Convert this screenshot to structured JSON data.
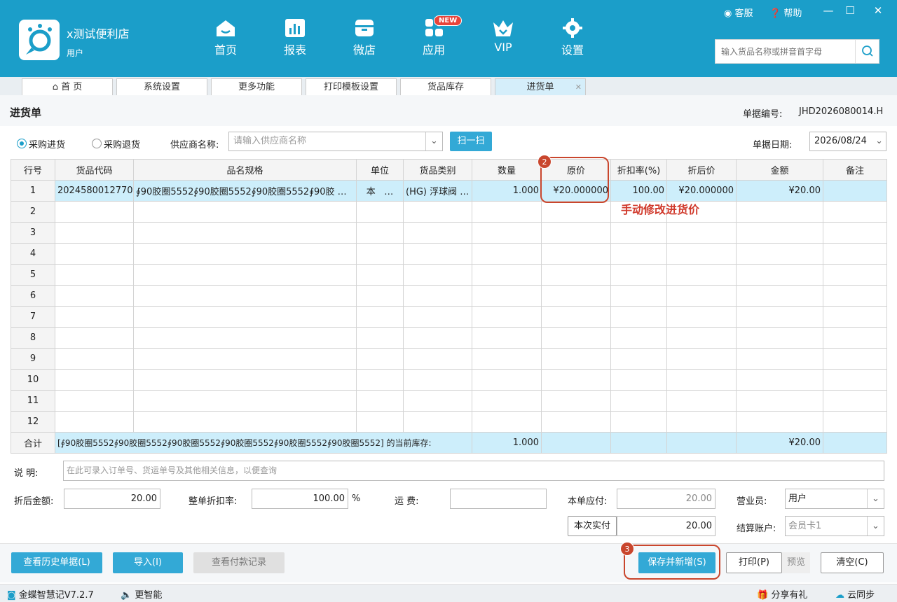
{
  "app": {
    "shop_name": "x测试便利店",
    "user": "用户"
  },
  "nav": [
    {
      "label": "首页",
      "icon": "home-icon"
    },
    {
      "label": "报表",
      "icon": "report-icon"
    },
    {
      "label": "微店",
      "icon": "store-icon"
    },
    {
      "label": "应用",
      "icon": "apps-icon",
      "badge": "NEW"
    },
    {
      "label": "VIP",
      "icon": "vip-crown-icon"
    },
    {
      "label": "设置",
      "icon": "gear-icon"
    }
  ],
  "top_links": {
    "service": "客服",
    "help": "帮助"
  },
  "search": {
    "placeholder": "输入货品名称或拼音首字母"
  },
  "tabs": [
    "首 页",
    "系统设置",
    "更多功能",
    "打印模板设置",
    "货品库存",
    "进货单"
  ],
  "page": {
    "title": "进货单",
    "docno_label": "单据编号:",
    "docno": "JHD2026080014.H"
  },
  "form": {
    "radio_purchase": "采购进货",
    "radio_return": "采购退货",
    "supplier_label": "供应商名称:",
    "supplier_placeholder": "请输入供应商名称",
    "scan_button": "扫一扫",
    "date_label": "单据日期:",
    "date_value": "2026/08/24"
  },
  "grid": {
    "headers": [
      "行号",
      "货品代码",
      "品名规格",
      "单位",
      "货品类别",
      "数量",
      "原价",
      "折扣率(%)",
      "折后价",
      "金额",
      "备注"
    ],
    "row1": {
      "no": "1",
      "code": "2024580012770",
      "name": "∮90胶圈5552∮90胶圈5552∮90胶圈5552∮90胶",
      "unit": "本",
      "category": "(HG) 浮球阀",
      "qty": "1.000",
      "price": "¥20.000000",
      "discount": "100.00",
      "after_price": "¥20.000000",
      "amount": "¥20.00",
      "remark": ""
    },
    "empty_rows": [
      "2",
      "3",
      "4",
      "5",
      "6",
      "7",
      "8",
      "9",
      "10",
      "11",
      "12"
    ],
    "summary": {
      "label": "合计",
      "stock_text": "[∮90胶圈5552∮90胶圈5552∮90胶圈5552∮90胶圈5552∮90胶圈5552∮90胶圈5552] 的当前库存:",
      "qty": "1.000",
      "amount": "¥20.00"
    }
  },
  "annotation": {
    "callout_2": "2",
    "text": "手动修改进货价",
    "callout_3": "3"
  },
  "footer": {
    "note_label": "说  明:",
    "note_placeholder": "在此可录入订单号、货运单号及其他相关信息，以便查询",
    "after_amount_label": "折后金额:",
    "after_amount": "20.00",
    "whole_discount_label": "整单折扣率:",
    "whole_discount": "100.00",
    "percent": "%",
    "freight_label": "运  费:",
    "freight": "",
    "payable_label": "本单应付:",
    "payable": "20.00",
    "paid_button": "本次实付",
    "paid": "20.00",
    "salesman_label": "营业员:",
    "salesman": "用户",
    "account_label": "结算账户:",
    "account": "会员卡1"
  },
  "buttons": {
    "history": "查看历史单据(L)",
    "import": "导入(I)",
    "payments": "查看付款记录",
    "save_new": "保存并新增(S)",
    "print": "打印(P)",
    "preview": "预览",
    "clear": "清空(C)"
  },
  "status": {
    "version": "金蝶智慧记V7.2.7",
    "notice": "更智能",
    "share": "分享有礼",
    "sync": "云同步"
  },
  "colors": {
    "header": "#1b9ec9",
    "accent": "#33a9d6",
    "callout": "#c9462d",
    "annotation": "#d0392b"
  }
}
